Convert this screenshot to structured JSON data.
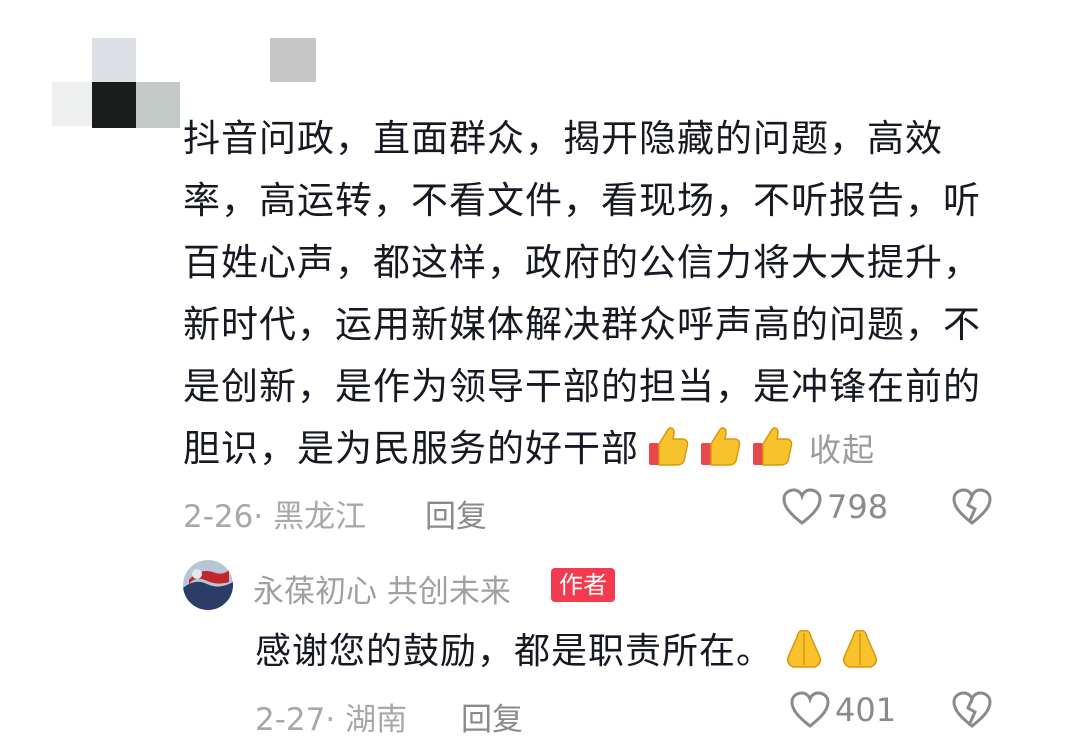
{
  "comment": {
    "text": "抖音问政，直面群众，揭开隐藏的问题，高效率，高运转，不看文件，看现场，不听报告，听百姓心声，都这样，政府的公信力将大大提升，新时代，运用新媒体解决群众呼声高的问题，不是创新，是作为领导干部的担当，是冲锋在前的胆识，是为民服务的好干部",
    "emoji": [
      "thumbs-up",
      "thumbs-up",
      "thumbs-up"
    ],
    "collapse_label": "收起",
    "date_location": "2-26· 黑龙江",
    "reply_label": "回复",
    "like_count": "798"
  },
  "reply": {
    "author_name": "永葆初心  共创未来",
    "author_badge": "作者",
    "text": "感谢您的鼓励，都是职责所在。",
    "emoji": [
      "folded-hands",
      "folded-hands"
    ],
    "date_location": "2-27· 湖南",
    "reply_label": "回复",
    "like_count": "401"
  },
  "colors": {
    "text_primary": "#161823",
    "text_secondary": "#a8a8a8",
    "badge_red": "#f33a4f"
  }
}
